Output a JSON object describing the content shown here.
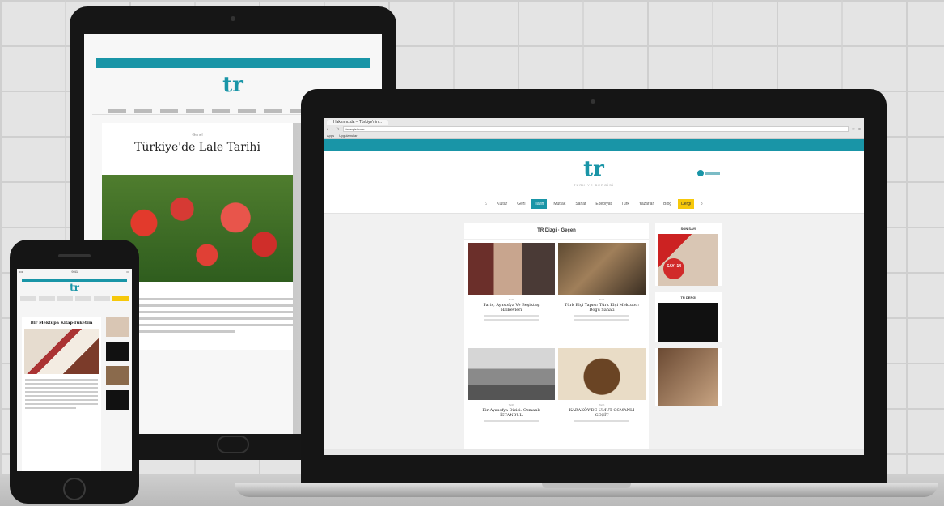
{
  "tablet": {
    "logo": "tr",
    "article_category": "Genel",
    "article_title": "Türkiye'de Lale Tarihi"
  },
  "laptop": {
    "browser": {
      "tab_title": "Hakkımızda – Türkiye'nin...",
      "url": "trdergisi.com",
      "bookmarks": [
        "Apps",
        "Uygulamalar"
      ]
    },
    "site": {
      "logo": "tr",
      "logo_subtitle": "TÜRKİYE DERGİSİ",
      "nav": [
        {
          "label": "Kültür",
          "active": false
        },
        {
          "label": "Gezi",
          "active": false
        },
        {
          "label": "Tarih",
          "active": true
        },
        {
          "label": "Mutfak",
          "active": false
        },
        {
          "label": "Sanat",
          "active": false
        },
        {
          "label": "Edebiyat",
          "active": false
        },
        {
          "label": "Türk",
          "active": false
        },
        {
          "label": "Yazarlar",
          "active": false
        },
        {
          "label": "Blog",
          "active": false
        },
        {
          "label": "Dergi",
          "active": false,
          "highlight": "yellow"
        }
      ],
      "section_title": "TR Dizgi · Geçen",
      "articles": [
        {
          "category": "Tarih",
          "title": "Paris, Ayasofya Ve Beşiktaş Halkevleri"
        },
        {
          "category": "Tarih",
          "title": "Türk Elçi Yapısı: Türk Elçi Mektubu: Doğu Sanatı"
        },
        {
          "category": "Tarih",
          "title": "Bir Ayasofya Dizisi: Osmanlı İSTANBUL"
        },
        {
          "category": "Tarih",
          "title": "KARAKÖY'DE UMUT OSMANLI GEÇİT"
        }
      ],
      "sidebar": {
        "ad_title": "SON SAYI",
        "cover_badge": "SAYI 14",
        "video_title": "TR DERGİ"
      }
    }
  },
  "phone": {
    "time": "9:41",
    "logo": "tr",
    "article_title": "Bir Mektupa Kitap-Tüketim"
  }
}
